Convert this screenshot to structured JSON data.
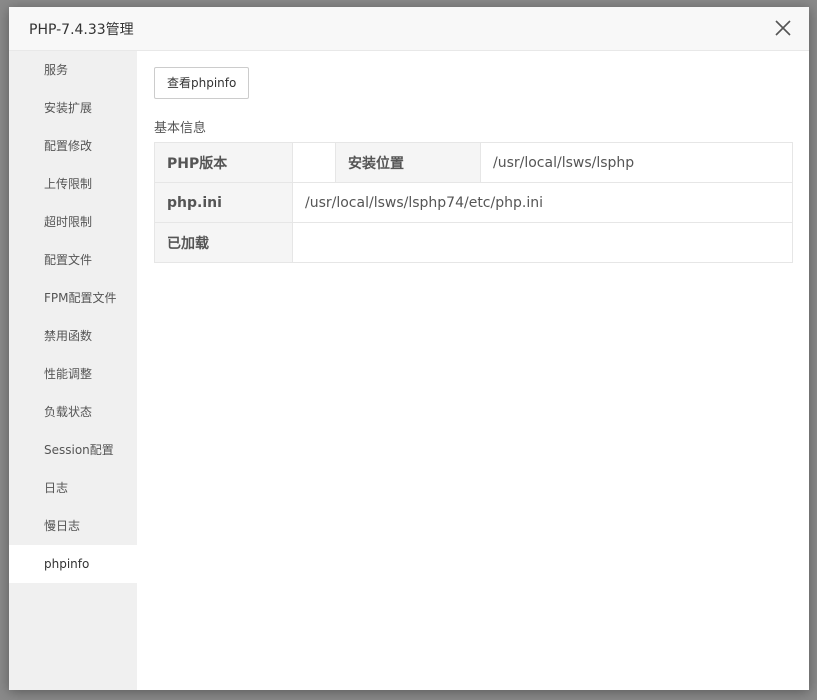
{
  "modal": {
    "title": "PHP-7.4.33管理"
  },
  "sidebar": {
    "items": [
      {
        "label": "服务"
      },
      {
        "label": "安装扩展"
      },
      {
        "label": "配置修改"
      },
      {
        "label": "上传限制"
      },
      {
        "label": "超时限制"
      },
      {
        "label": "配置文件"
      },
      {
        "label": "FPM配置文件"
      },
      {
        "label": "禁用函数"
      },
      {
        "label": "性能调整"
      },
      {
        "label": "负载状态"
      },
      {
        "label": "Session配置"
      },
      {
        "label": "日志"
      },
      {
        "label": "慢日志"
      },
      {
        "label": "phpinfo"
      }
    ],
    "active_index": 13
  },
  "content": {
    "view_phpinfo_button": "查看phpinfo",
    "section_title": "基本信息",
    "table": {
      "php_version_label": "PHP版本",
      "php_version_value": "",
      "install_location_label": "安装位置",
      "install_location_value": "/usr/local/lsws/lsphp",
      "php_ini_label": "php.ini",
      "php_ini_value": "/usr/local/lsws/lsphp74/etc/php.ini",
      "loaded_label": "已加载",
      "loaded_value": ""
    }
  }
}
